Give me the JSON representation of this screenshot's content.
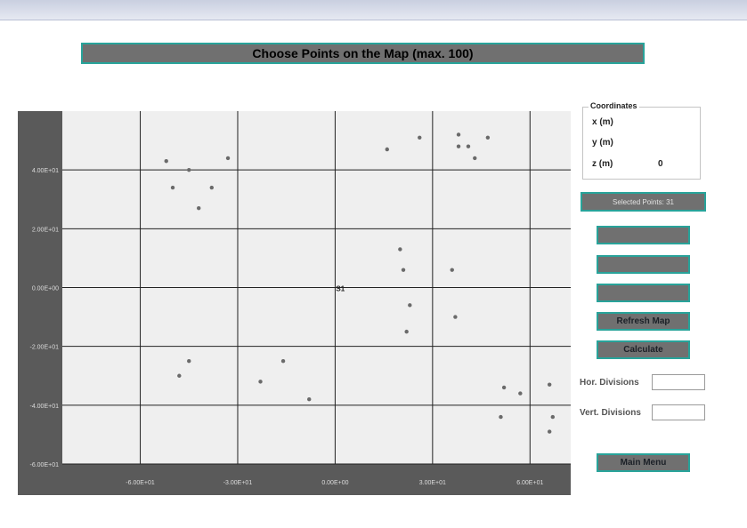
{
  "title": "Choose Points on the Map (max. 100)",
  "coordinates": {
    "legend": "Coordinates",
    "x_label": "x (m)",
    "y_label": "y (m)",
    "z_label": "z (m)",
    "x_value": "",
    "y_value": "",
    "z_value": "0"
  },
  "selected_points": "Selected Points: 31",
  "buttons": {
    "blank1": "",
    "blank2": "",
    "blank3": "",
    "refresh": "Refresh Map",
    "calculate": "Calculate",
    "main_menu": "Main Menu"
  },
  "divisions": {
    "hor_label": "Hor. Divisions",
    "hor_value": "",
    "vert_label": "Vert. Divisions",
    "vert_value": ""
  },
  "colors": {
    "accent_border": "#28a39a",
    "button_fill": "#707070",
    "plot_background": "#efefef",
    "frame": "#5a5a5a"
  },
  "chart_data": {
    "type": "scatter",
    "x_ticks": [
      "-6.00E+01",
      "-3.00E+01",
      "0.00E+00",
      "3.00E+01",
      "6.00E+01"
    ],
    "y_ticks": [
      "4.00E+01",
      "2.00E+01",
      "0.00E+00",
      "-2.00E+01",
      "-4.00E+01",
      "-6.00E+01"
    ],
    "xlim": [
      -84,
      75
    ],
    "ylim": [
      -60,
      60
    ],
    "grid": true,
    "origin_label": "S1",
    "points": [
      {
        "x": -52,
        "y": 43
      },
      {
        "x": -45,
        "y": 40
      },
      {
        "x": -33,
        "y": 44
      },
      {
        "x": -50,
        "y": 34
      },
      {
        "x": -38,
        "y": 34
      },
      {
        "x": -42,
        "y": 27
      },
      {
        "x": 16,
        "y": 47
      },
      {
        "x": 26,
        "y": 51
      },
      {
        "x": 38,
        "y": 52
      },
      {
        "x": 38,
        "y": 48
      },
      {
        "x": 41,
        "y": 48
      },
      {
        "x": 43,
        "y": 44
      },
      {
        "x": 47,
        "y": 51
      },
      {
        "x": 20,
        "y": 13
      },
      {
        "x": 21,
        "y": 6
      },
      {
        "x": 36,
        "y": 6
      },
      {
        "x": 23,
        "y": -6
      },
      {
        "x": 37,
        "y": -10
      },
      {
        "x": 22,
        "y": -15
      },
      {
        "x": -45,
        "y": -25
      },
      {
        "x": -48,
        "y": -30
      },
      {
        "x": -16,
        "y": -25
      },
      {
        "x": -23,
        "y": -32
      },
      {
        "x": -8,
        "y": -38
      },
      {
        "x": 52,
        "y": -34
      },
      {
        "x": 57,
        "y": -36
      },
      {
        "x": 66,
        "y": -33
      },
      {
        "x": 74,
        "y": -34
      },
      {
        "x": 51,
        "y": -44
      },
      {
        "x": 67,
        "y": -44
      },
      {
        "x": 66,
        "y": -49
      }
    ]
  }
}
